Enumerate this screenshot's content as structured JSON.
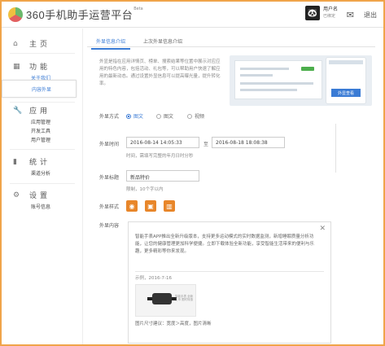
{
  "header": {
    "logo_text": "360手机助手运营平台",
    "logo_badge": "Beta",
    "user_name": "用户名",
    "user_sub": "已绑定",
    "logout_label": "退出"
  },
  "sidebar": {
    "home": "主页",
    "features_title": "功能",
    "features_items": [
      "关于我们",
      "内容外显"
    ],
    "features_active": "内容外显",
    "apps_title": "应用",
    "apps_items": [
      "应用管理",
      "开发工具",
      "用户管理"
    ],
    "stats_title": "统计",
    "stats_items": [
      "渠道分析"
    ],
    "settings_title": "设置",
    "settings_items": [
      "账号信息"
    ]
  },
  "tabs": [
    "外显信息介绍",
    "上次外显信息介绍"
  ],
  "intro_text": "外显是指在应用详情页、榜单、搜索结果等位置中展示对应应用的特色内容，包括活动、礼包等，可以帮助用户快速了解应用的最新动态。通过设置外显信息可以提高曝光量，提升转化率。",
  "preview_button": "外显查看",
  "form": {
    "type_label": "外显方式",
    "type_options": [
      "图文",
      "图文",
      "视频"
    ],
    "time_label": "外显时间",
    "time_start": "2016-08-14 14:05:33",
    "time_sep": "至",
    "time_end": "2016-08-18 18:08:38",
    "time_hint": "时间，需填写完整的年月日时分秒",
    "title_label": "外显标题",
    "title_value": "新品特价",
    "title_hint": "限制，10个字以内",
    "style_label": "外显样式",
    "content_label": "外显内容"
  },
  "editor": {
    "text": "智能手表APP推出全新升级版本，支持更多运动模式的实时数据监测，新增睡眠质量分析功能，让您的健康管理更加科学便捷。立即下载体验全新功能，享受智能生活带来的便利与乐趣，更多精彩等你来发现。",
    "example_label": "示例，2016-7-16",
    "image_caption": "智能手表 全新上市 限时特惠",
    "footer_text": "图片尺寸建议：宽度＞高度，图片清晰"
  },
  "colors": {
    "accent": "#3a7bd5",
    "orange": "#e8862a",
    "frame": "#f0a44a"
  }
}
